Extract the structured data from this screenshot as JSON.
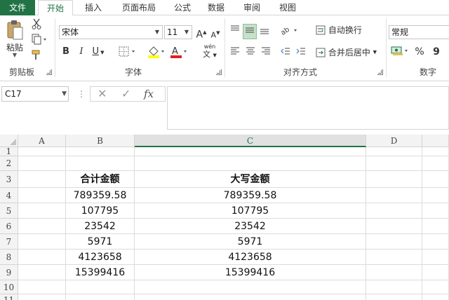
{
  "tabs": {
    "file": "文件",
    "home": "开始",
    "insert": "插入",
    "page_layout": "页面布局",
    "formulas": "公式",
    "data": "数据",
    "review": "审阅",
    "view": "视图"
  },
  "ribbon": {
    "clipboard": {
      "paste_label": "粘贴",
      "group_label": "剪贴板"
    },
    "font": {
      "font_name": "宋体",
      "font_size": "11",
      "bold": "B",
      "italic": "I",
      "underline": "U",
      "grow": "A",
      "shrink": "A",
      "group_label": "字体",
      "phonetic": "wén"
    },
    "alignment": {
      "wrap_text": "自动换行",
      "merge_center": "合并后居中",
      "group_label": "对齐方式"
    },
    "number": {
      "format": "常规",
      "percent": "%",
      "comma": "9",
      "group_label": "数字"
    }
  },
  "formula_bar": {
    "name_box": "C17",
    "cancel": "✕",
    "enter": "✓",
    "fx": "fx",
    "value": ""
  },
  "sheet": {
    "columns": [
      "A",
      "B",
      "C",
      "D"
    ],
    "selected_column": "C",
    "rows": [
      "1",
      "2",
      "3",
      "4",
      "5",
      "6",
      "7",
      "8",
      "9",
      "10",
      "11"
    ],
    "headers": {
      "b": "合计金额",
      "c": "大写金额"
    },
    "values_b": [
      "789359.58",
      "107795",
      "23542",
      "5971",
      "4123658",
      "15399416"
    ],
    "values_c": [
      "789359.58",
      "107795",
      "23542",
      "5971",
      "4123658",
      "15399416"
    ]
  },
  "colors": {
    "accent": "#217346",
    "header_bg": "#f3f3f3",
    "gridline": "#dcdcdc"
  },
  "icons": [
    "clipboard-paste-icon",
    "cut-icon",
    "copy-icon",
    "format-painter-icon",
    "fill-color-icon",
    "font-color-icon",
    "border-icon",
    "align-icons",
    "orientation-icon",
    "indent-icons",
    "wrap-text-icon",
    "merge-icon",
    "currency-icon",
    "percent-icon",
    "comma-icon",
    "cancel-icon",
    "enter-icon",
    "fx-icon",
    "more-icon"
  ]
}
